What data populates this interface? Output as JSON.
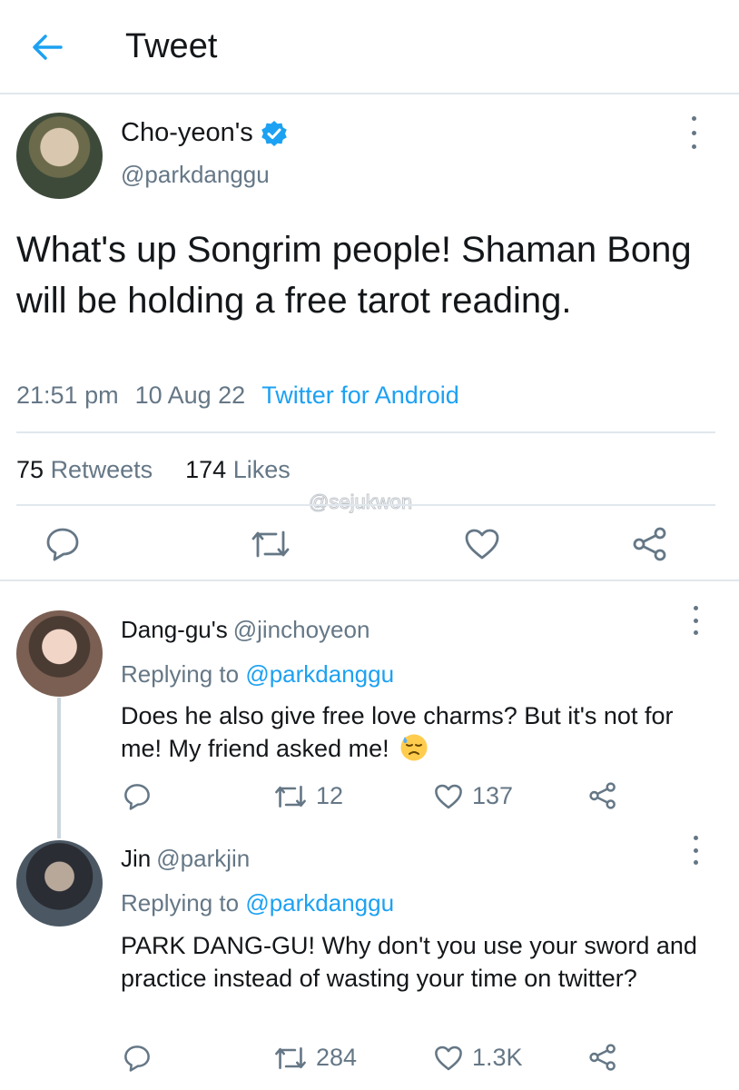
{
  "header": {
    "title": "Tweet",
    "back_icon": "arrow-left-icon"
  },
  "tweet": {
    "author_name": "Cho-yeon's",
    "author_handle": "@parkdanggu",
    "verified": true,
    "text": "What's up Songrim people! Shaman Bong will be holding a free tarot reading.",
    "time": "21:51 pm",
    "date": "10 Aug 22",
    "source": "Twitter for Android",
    "retweets_count": "75",
    "retweets_label": "Retweets",
    "likes_count": "174",
    "likes_label": "Likes",
    "watermark": "@sejukwon"
  },
  "replies": [
    {
      "name": "Dang-gu's",
      "handle": "@jinchoyeon",
      "replying_prefix": "Replying to",
      "replying_to": "@parkdanggu",
      "text": "Does he also give free love charms? But it's not for me! My friend asked me!",
      "emoji": "downcast-face-with-sweat",
      "retweets": "12",
      "likes": "137"
    },
    {
      "name": "Jin",
      "handle": "@parkjin",
      "replying_prefix": "Replying to",
      "replying_to": "@parkdanggu",
      "text": "PARK DANG-GU! Why don't you use your sword and practice instead of wasting your time on twitter?",
      "retweets": "284",
      "likes": "1.3K"
    }
  ],
  "colors": {
    "accent": "#1da1f2",
    "secondary_text": "#657786",
    "primary_text": "#14171a",
    "divider": "#e1e8ed"
  }
}
